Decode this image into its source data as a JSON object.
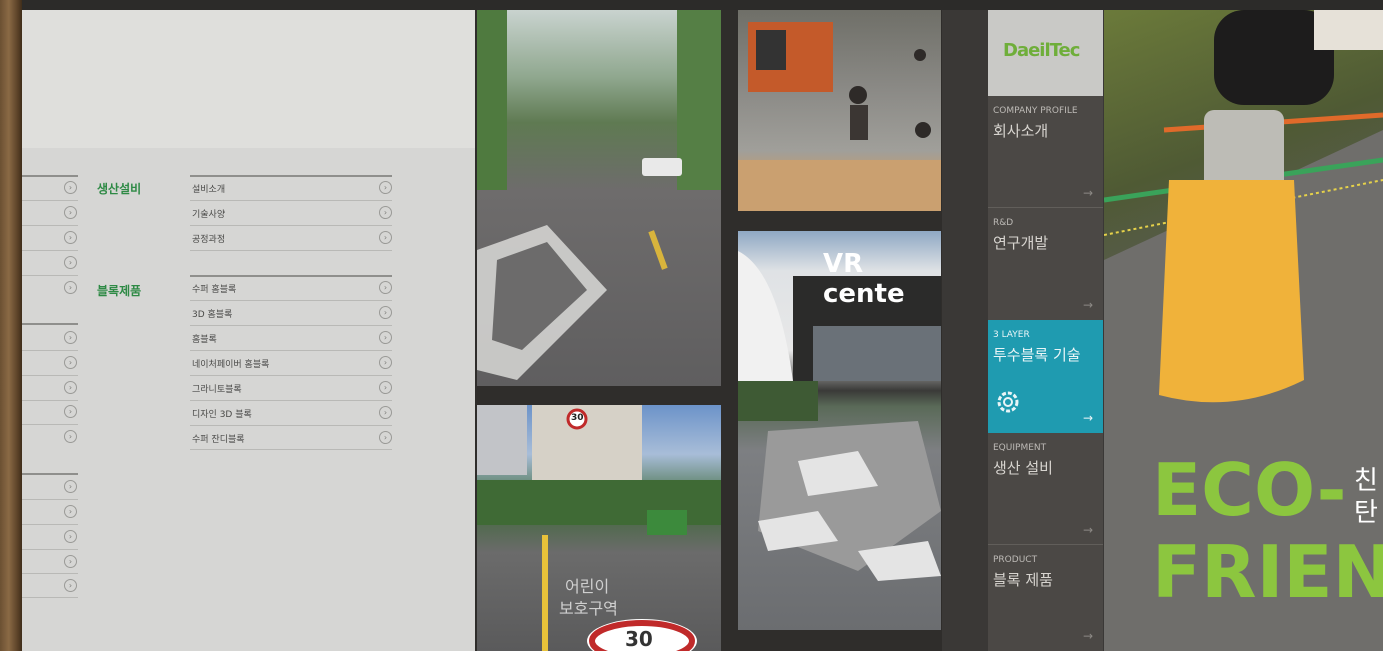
{
  "left_menu": {
    "groups": [
      {
        "category": "생산설비",
        "items": [
          "설비소개",
          "기술사양",
          "공정과정"
        ]
      },
      {
        "category": "블록제품",
        "items": [
          "수퍼 홈블록",
          "3D 홈블록",
          "홈블록",
          "네이처페이버 홈블록",
          "그라니토블록",
          "디자인 3D 블록",
          "수퍼 잔디블록"
        ]
      }
    ],
    "chevron": "›"
  },
  "photos": {
    "road": "",
    "vr_sign": "VR cente",
    "school_sign": "30",
    "school_road_text": [
      "어린이",
      "보호구역"
    ],
    "school_marking": "30"
  },
  "brand": {
    "logo": "DaeilTec",
    "accent_color": "#1f9bb0",
    "eco_color": "#8cc63f"
  },
  "sidebar": {
    "sections": [
      {
        "en": "COMPANY PROFILE",
        "ko": "회사소개",
        "arrow": "→"
      },
      {
        "en": "R&D",
        "ko": "연구개발",
        "arrow": "→"
      },
      {
        "en": "3 LAYER",
        "ko": "투수블록 기술",
        "arrow": "→",
        "icon": "gear-icon"
      },
      {
        "en": "EQUIPMENT",
        "ko": "생산 설비",
        "arrow": "→"
      },
      {
        "en": "PRODUCT",
        "ko": "블록 제품",
        "arrow": "→"
      }
    ]
  },
  "hero": {
    "line1": "ECO-",
    "line2": "FRIEN",
    "side1": "친",
    "side2": "탄"
  }
}
